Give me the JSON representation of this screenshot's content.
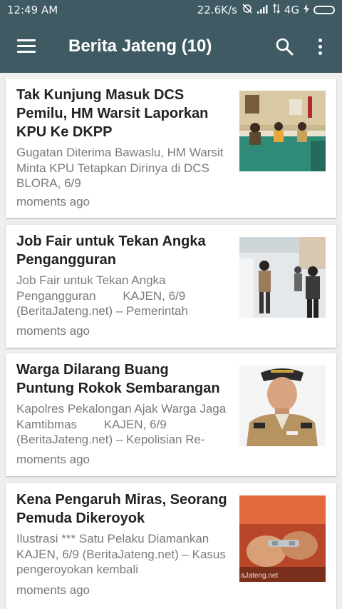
{
  "status_bar": {
    "time": "12:49 AM",
    "speed": "22.6K/s",
    "network": "4G",
    "icons": [
      "alarm-off-icon",
      "signal-icon",
      "data-arrows-icon",
      "charging-icon",
      "battery-icon"
    ]
  },
  "app_bar": {
    "title": "Berita Jateng (10)",
    "icons": [
      "menu-icon",
      "search-icon",
      "more-vert-icon"
    ]
  },
  "colors": {
    "app_bar": "#3f5a63",
    "background": "#eeeeee",
    "card": "#ffffff",
    "headline": "#222222",
    "summary": "#7b7b7b"
  },
  "articles": [
    {
      "headline": "Tak Kunjung Masuk DCS Pemilu, HM Warsit Laporkan KPU Ke DKPP",
      "summary": "Gugatan Diterima Bawaslu, HM Warsit Minta KPU Tetapkan Dirinya di DCS        BLORA, 6/9",
      "time": "moments ago"
    },
    {
      "headline": "Job Fair untuk Tekan Angka Pengangguran",
      "summary": "Job Fair untuk Tekan Angka Pengangguran        KAJEN, 6/9 (BeritaJateng.net) – Pemerintah",
      "time": "moments ago"
    },
    {
      "headline": "Warga Dilarang Buang Puntung Rokok Sembarangan",
      "summary": "Kapolres Pekalongan Ajak Warga Jaga Kamtibmas        KAJEN, 6/9 (BeritaJateng.net) – Kepolisian Re-",
      "time": "moments ago"
    },
    {
      "headline": "Kena Pengaruh Miras, Seorang Pemuda Dikeroyok",
      "summary": "Ilustrasi *** Satu Pelaku Diamankan        KAJEN, 6/9 (BeritaJateng.net) – Kasus pengeroyokan kembali",
      "time": "moments ago",
      "thumb_caption": "aJateng.net"
    }
  ]
}
